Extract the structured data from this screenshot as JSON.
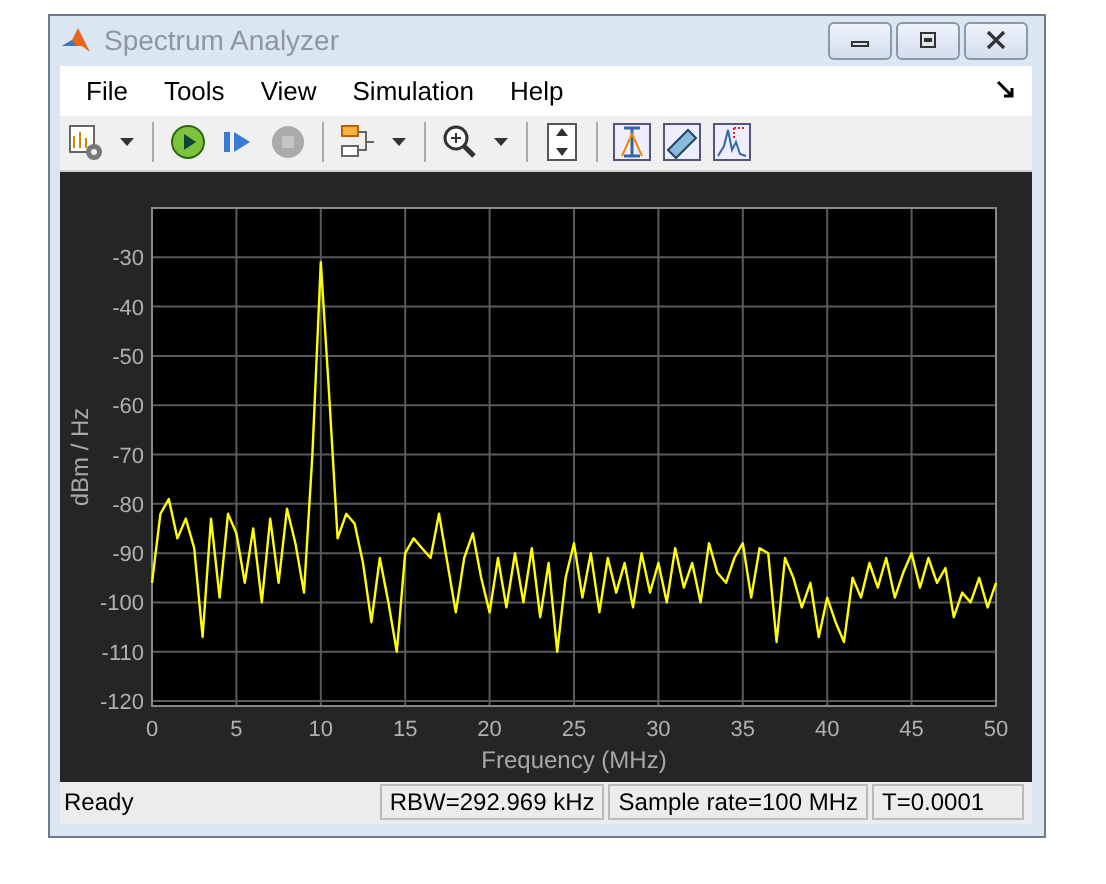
{
  "window": {
    "title": "Spectrum Analyzer"
  },
  "menu": [
    "File",
    "Tools",
    "View",
    "Simulation",
    "Help"
  ],
  "toolbar": [
    {
      "kind": "settings",
      "disabled": false
    },
    {
      "kind": "caret"
    },
    {
      "kind": "sep"
    },
    {
      "kind": "run",
      "disabled": false
    },
    {
      "kind": "step",
      "disabled": false
    },
    {
      "kind": "stop",
      "disabled": true
    },
    {
      "kind": "sep"
    },
    {
      "kind": "signals",
      "disabled": false
    },
    {
      "kind": "caret"
    },
    {
      "kind": "sep"
    },
    {
      "kind": "zoom",
      "disabled": false
    },
    {
      "kind": "caret"
    },
    {
      "kind": "sep"
    },
    {
      "kind": "scale",
      "disabled": false
    },
    {
      "kind": "sep"
    },
    {
      "kind": "cursor",
      "disabled": false
    },
    {
      "kind": "ruler",
      "disabled": false
    },
    {
      "kind": "peaks",
      "disabled": false
    }
  ],
  "plot": {
    "chart_data": {
      "type": "line",
      "grid": true,
      "xlabel": "Frequency (MHz)",
      "ylabel": "dBm / Hz",
      "xlim": [
        0,
        50
      ],
      "ylim": [
        -121,
        -20
      ],
      "xticks": [
        0,
        5,
        10,
        15,
        20,
        25,
        30,
        35,
        40,
        45,
        50
      ],
      "yticks": [
        -120,
        -110,
        -100,
        -90,
        -80,
        -70,
        -60,
        -50,
        -40,
        -30
      ],
      "x": [
        0,
        0.5,
        1,
        1.5,
        2,
        2.5,
        3,
        3.5,
        4,
        4.5,
        5,
        5.5,
        6,
        6.5,
        7,
        7.5,
        8,
        8.5,
        9,
        9.5,
        10,
        10.5,
        11,
        11.5,
        12,
        12.5,
        13,
        13.5,
        14,
        14.5,
        15,
        15.5,
        16,
        16.5,
        17,
        17.5,
        18,
        18.5,
        19,
        19.5,
        20,
        20.5,
        21,
        21.5,
        22,
        22.5,
        23,
        23.5,
        24,
        24.5,
        25,
        25.5,
        26,
        26.5,
        27,
        27.5,
        28,
        28.5,
        29,
        29.5,
        30,
        30.5,
        31,
        31.5,
        32,
        32.5,
        33,
        33.5,
        34,
        34.5,
        35,
        35.5,
        36,
        36.5,
        37,
        37.5,
        38,
        38.5,
        39,
        39.5,
        40,
        40.5,
        41,
        41.5,
        42,
        42.5,
        43,
        43.5,
        44,
        44.5,
        45,
        45.5,
        46,
        46.5,
        47,
        47.5,
        48,
        48.5,
        49,
        49.5,
        50
      ],
      "series": [
        {
          "color": "#ffff00",
          "values": [
            -96,
            -82,
            -79,
            -87,
            -83,
            -89,
            -107,
            -83,
            -99,
            -82,
            -86,
            -96,
            -85,
            -100,
            -83,
            -96,
            -81,
            -88,
            -98,
            -70,
            -31,
            -58,
            -87,
            -82,
            -84,
            -92,
            -104,
            -91,
            -100,
            -110,
            -90,
            -87,
            -89,
            -91,
            -82,
            -92,
            -102,
            -91,
            -86,
            -95,
            -102,
            -91,
            -101,
            -90,
            -100,
            -89,
            -103,
            -92,
            -110,
            -95,
            -88,
            -99,
            -90,
            -102,
            -91,
            -98,
            -92,
            -101,
            -90,
            -98,
            -92,
            -100,
            -89,
            -97,
            -92,
            -100,
            -88,
            -94,
            -96,
            -91,
            -88,
            -99,
            -89,
            -90,
            -108,
            -91,
            -95,
            -101,
            -96,
            -107,
            -99,
            -104,
            -108,
            -95,
            -99,
            -92,
            -97,
            -91,
            -99,
            -94,
            -90,
            -97,
            -91,
            -96,
            -93,
            -103,
            -98,
            -100,
            -95,
            -101,
            -96
          ]
        }
      ]
    }
  },
  "status_bar": {
    "message": "Ready",
    "fields": [
      "RBW=292.969 kHz",
      "Sample rate=100 MHz",
      "T=0.0001"
    ]
  }
}
